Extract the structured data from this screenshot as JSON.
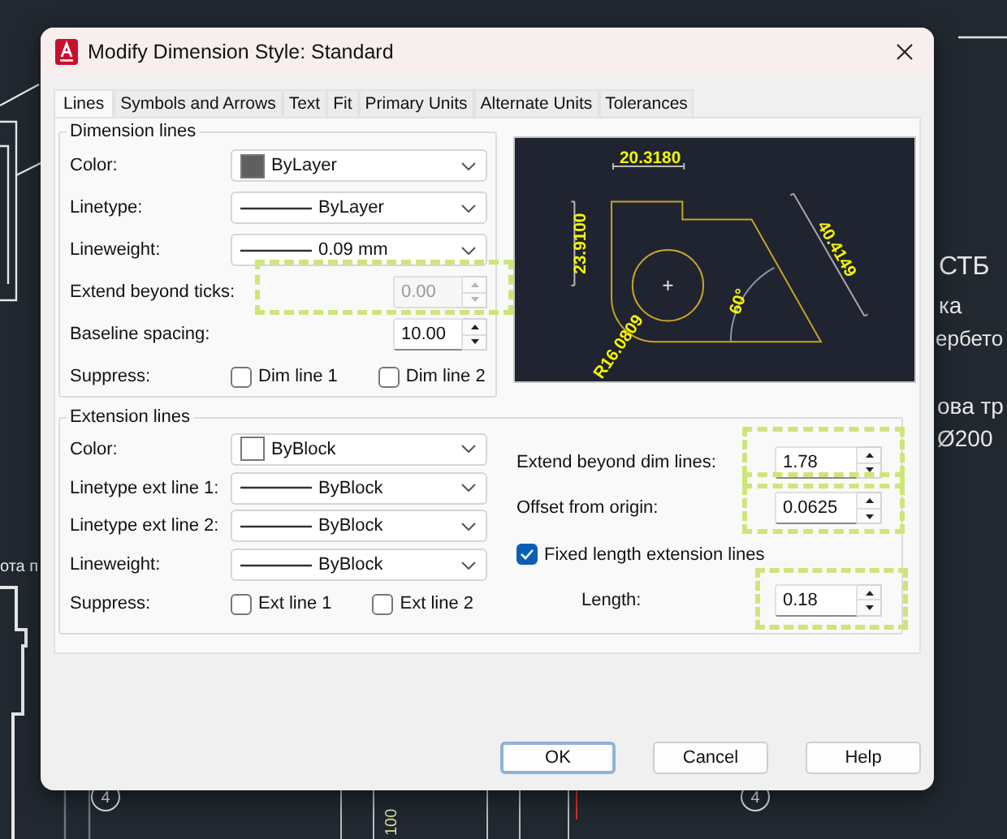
{
  "background": {
    "notes": [
      "СТБ",
      "ка",
      "ербето",
      "ова тр",
      "Ø200",
      "ота п"
    ],
    "callouts": [
      "4",
      "4"
    ],
    "dimension": "100"
  },
  "window": {
    "title": "Modify Dimension Style: Standard"
  },
  "tabs": [
    {
      "label": "Lines",
      "selected": true
    },
    {
      "label": "Symbols and Arrows",
      "selected": false
    },
    {
      "label": "Text",
      "selected": false
    },
    {
      "label": "Fit",
      "selected": false
    },
    {
      "label": "Primary Units",
      "selected": false
    },
    {
      "label": "Alternate Units",
      "selected": false
    },
    {
      "label": "Tolerances",
      "selected": false
    }
  ],
  "dimension_lines": {
    "title": "Dimension lines",
    "rows": [
      {
        "kind": "color",
        "label": "Color:",
        "value": "ByLayer",
        "color": "#5f5f5f"
      },
      {
        "kind": "line",
        "label": "Linetype:",
        "value": "ByLayer"
      },
      {
        "kind": "line",
        "label": "Lineweight:",
        "value": "0.09 mm"
      },
      {
        "kind": "spin",
        "label": "Extend beyond ticks:",
        "value": "0.00",
        "disabled": true,
        "highlighted": true
      },
      {
        "kind": "spin",
        "label": "Baseline spacing:",
        "value": "10.00",
        "disabled": false,
        "highlighted": false
      },
      {
        "kind": "suppress",
        "label": "Suppress:",
        "options": [
          {
            "label": "Dim line 1",
            "checked": false
          },
          {
            "label": "Dim line 2",
            "checked": false
          }
        ]
      }
    ]
  },
  "preview": {
    "labels": [
      "20.3180",
      "23.9100",
      "40.4149",
      "60°",
      "R16.0809"
    ]
  },
  "extension_lines": {
    "title": "Extension lines",
    "rows": [
      {
        "kind": "color",
        "label": "Color:",
        "value": "ByBlock",
        "color": "#ffffff"
      },
      {
        "kind": "line",
        "label": "Linetype ext line 1:",
        "value": "ByBlock"
      },
      {
        "kind": "line",
        "label": "Linetype ext line 2:",
        "value": "ByBlock"
      },
      {
        "kind": "line",
        "label": "Lineweight:",
        "value": "ByBlock"
      },
      {
        "kind": "suppress",
        "label": "Suppress:",
        "options": [
          {
            "label": "Ext line 1",
            "checked": false
          },
          {
            "label": "Ext line 2",
            "checked": false
          }
        ]
      }
    ],
    "settings": [
      {
        "kind": "spin",
        "label": "Extend beyond dim lines:",
        "value": "1.78",
        "disabled": false,
        "highlighted": true
      },
      {
        "kind": "spin",
        "label": "Offset from origin:",
        "value": "0.0625",
        "disabled": false,
        "highlighted": true
      },
      {
        "kind": "check",
        "label": "Fixed length extension lines",
        "checked": true
      },
      {
        "kind": "subspin",
        "label": "Length:",
        "value": "0.18",
        "disabled": false,
        "highlighted": true
      }
    ]
  },
  "buttons": [
    {
      "label": "OK",
      "default": true
    },
    {
      "label": "Cancel",
      "default": false
    },
    {
      "label": "Help",
      "default": false
    }
  ]
}
